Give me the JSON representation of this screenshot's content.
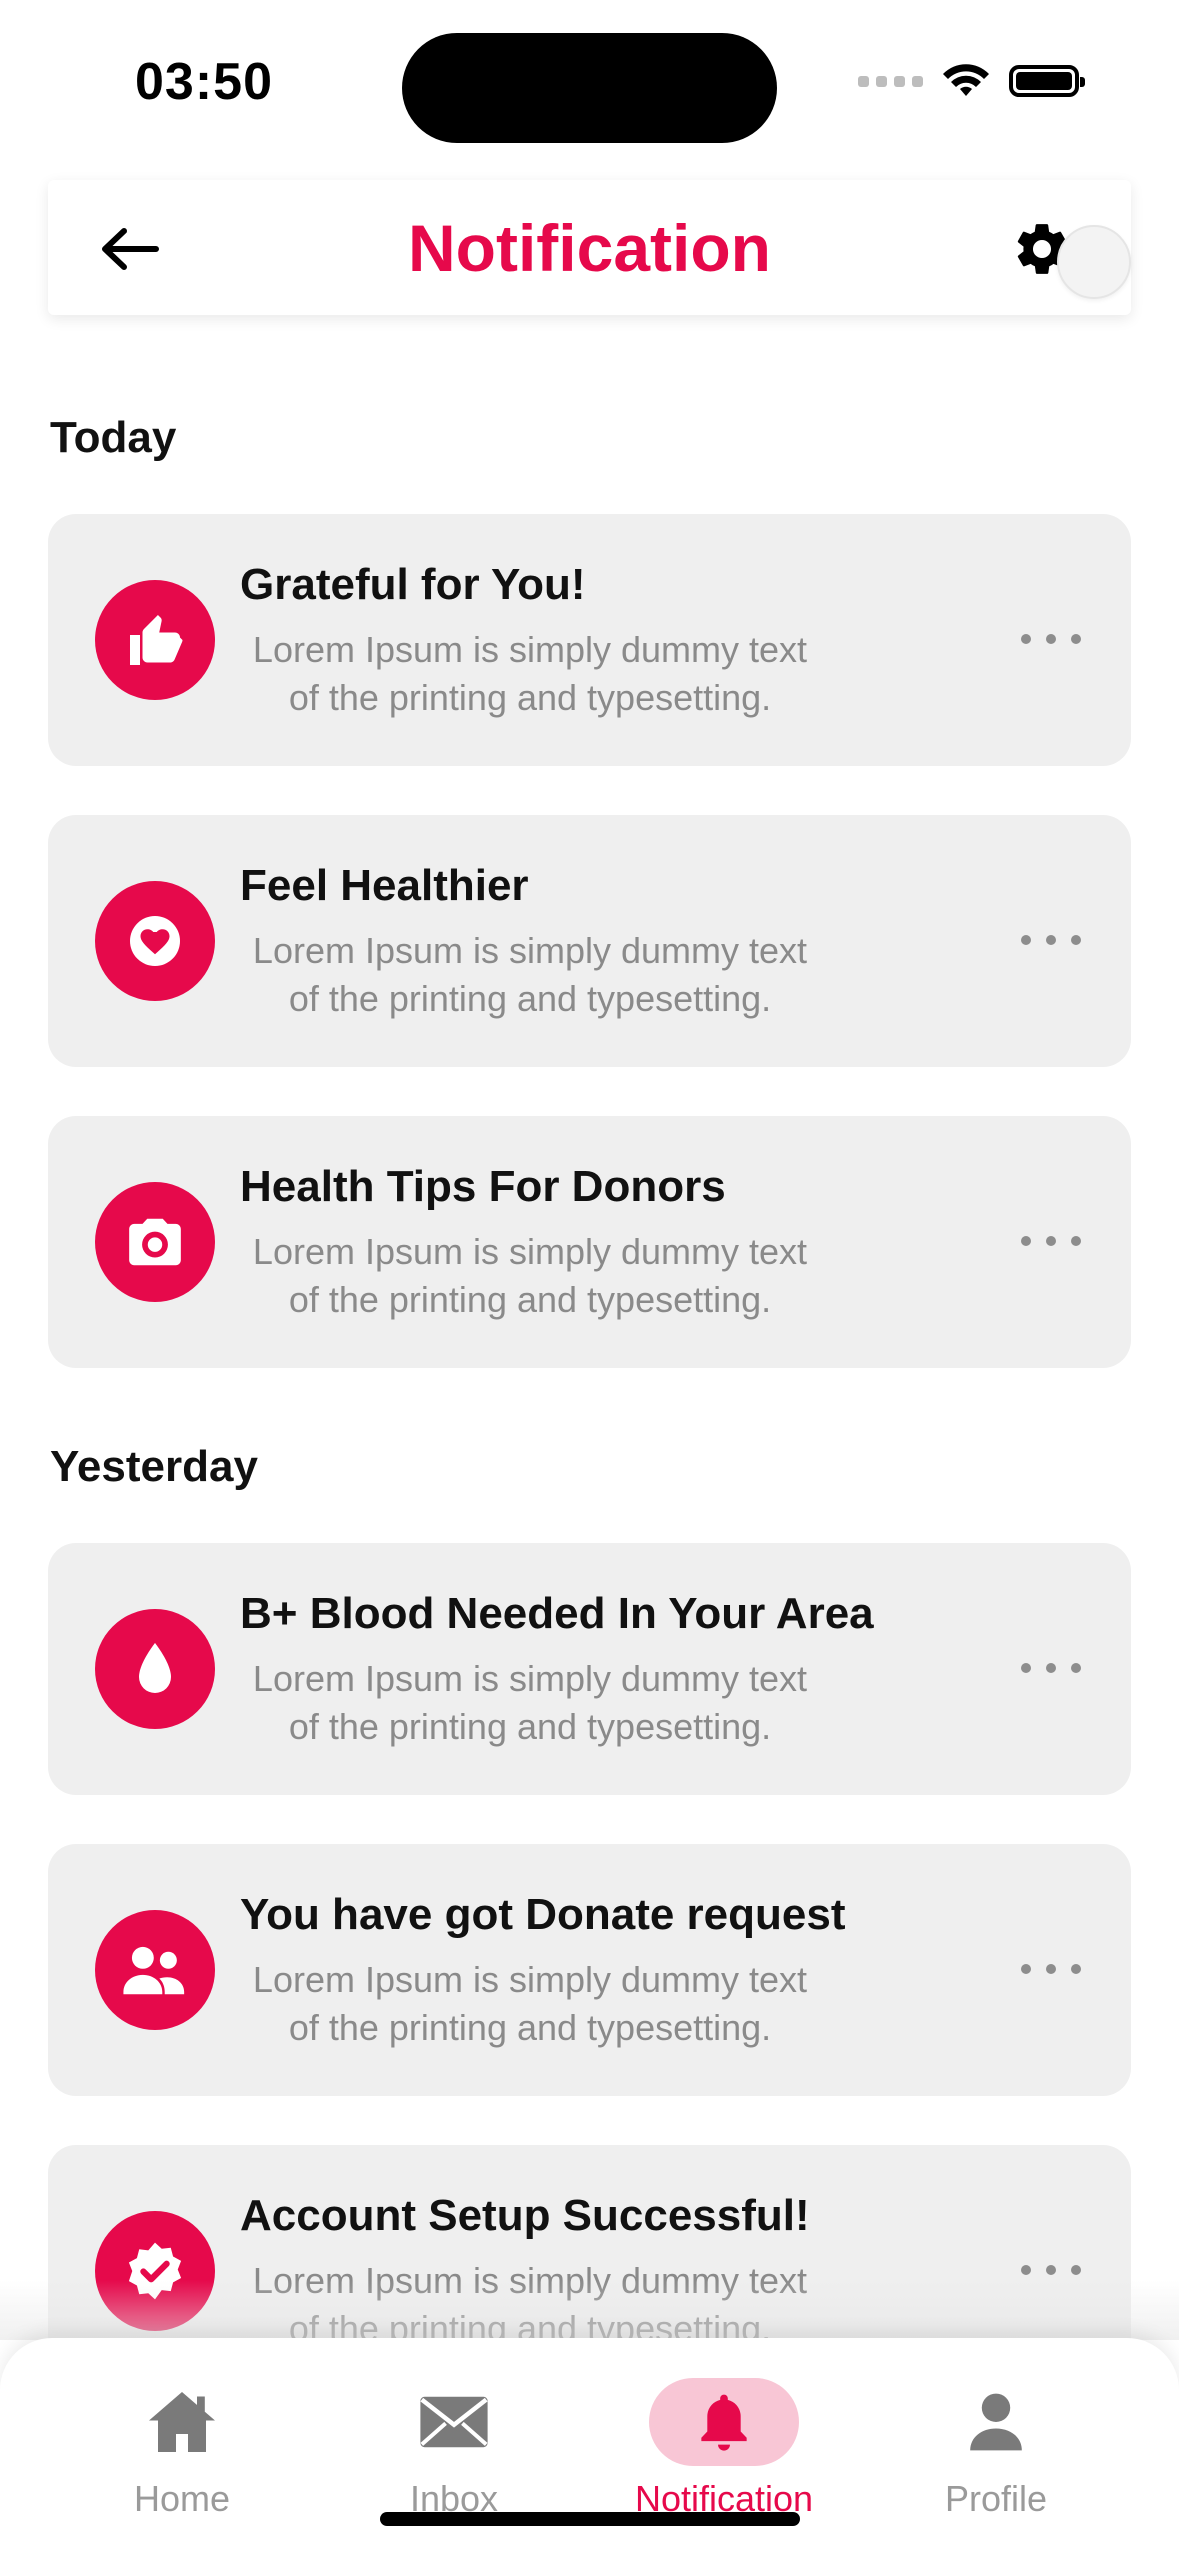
{
  "status_bar": {
    "time": "03:50"
  },
  "header": {
    "title": "Notification",
    "back_icon": "arrow-left-icon",
    "settings_icon": "gear-icon"
  },
  "sections": [
    {
      "title": "Today",
      "items": [
        {
          "title": "Grateful for You!",
          "description": "Lorem Ipsum is simply dummy text of the printing and typesetting.",
          "icon": "thumbs-up-icon"
        },
        {
          "title": "Feel Healthier",
          "description": "Lorem Ipsum is simply dummy text of the printing and typesetting.",
          "icon": "heart-circle-icon"
        },
        {
          "title": "Health Tips For Donors",
          "description": "Lorem Ipsum is simply dummy text of the printing and typesetting.",
          "icon": "camera-icon"
        }
      ]
    },
    {
      "title": "Yesterday",
      "items": [
        {
          "title": "B+ Blood Needed In Your Area",
          "description": "Lorem Ipsum is simply dummy text of the printing and typesetting.",
          "icon": "blood-drop-icon"
        },
        {
          "title": "You have got Donate request",
          "description": "Lorem Ipsum is simply dummy text of the printing and typesetting.",
          "icon": "users-icon"
        },
        {
          "title": "Account Setup Successful!",
          "description": "Lorem Ipsum is simply dummy text of the printing and typesetting.",
          "icon": "verified-badge-icon"
        }
      ]
    }
  ],
  "bottom_nav": {
    "items": [
      {
        "label": "Home",
        "icon": "home-icon",
        "active": false
      },
      {
        "label": "Inbox",
        "icon": "envelope-icon",
        "active": false
      },
      {
        "label": "Notification",
        "icon": "bell-icon",
        "active": true
      },
      {
        "label": "Profile",
        "icon": "person-icon",
        "active": false
      }
    ]
  },
  "colors": {
    "accent": "#e6094b",
    "accent_soft": "#f8c6d5",
    "card_background": "#efefef",
    "muted_text": "#8a8a8a"
  }
}
